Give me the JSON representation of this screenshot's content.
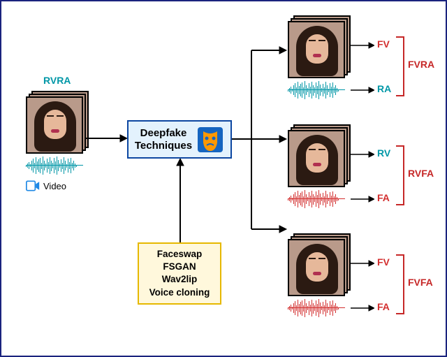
{
  "input": {
    "label": "RVRA",
    "video_caption": "Video"
  },
  "deepfake": {
    "title_line1": "Deepfake",
    "title_line2": "Techniques"
  },
  "methods": {
    "lines": [
      "Faceswap",
      "FSGAN",
      "Wav2lip",
      "Voice cloning"
    ]
  },
  "outputs": [
    {
      "video_label": "FV",
      "video_color": "red",
      "audio_label": "RA",
      "audio_color": "teal",
      "combo": "FVRA"
    },
    {
      "video_label": "RV",
      "video_color": "teal",
      "audio_label": "FA",
      "audio_color": "red",
      "combo": "RVFA"
    },
    {
      "video_label": "FV",
      "video_color": "red",
      "audio_label": "FA",
      "audio_color": "red",
      "combo": "FVFA"
    }
  ]
}
